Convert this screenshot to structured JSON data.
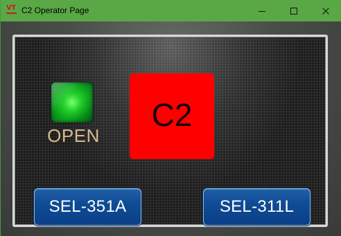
{
  "window": {
    "app_icon": "vt-logo",
    "app_icon_text": "VT",
    "title": "C2 Operator Page",
    "controls": [
      "minimize-icon",
      "maximize-icon",
      "close-icon"
    ]
  },
  "panel": {
    "breaker": {
      "indicator_color": "#1fc82a",
      "status": "OPEN",
      "status_color": "#d8b88e"
    },
    "unit": {
      "label": "C2",
      "color": "#ff0000"
    },
    "relays": [
      {
        "label": "SEL-351A"
      },
      {
        "label": "SEL-311L"
      }
    ],
    "button_color": "#0f4c95"
  }
}
